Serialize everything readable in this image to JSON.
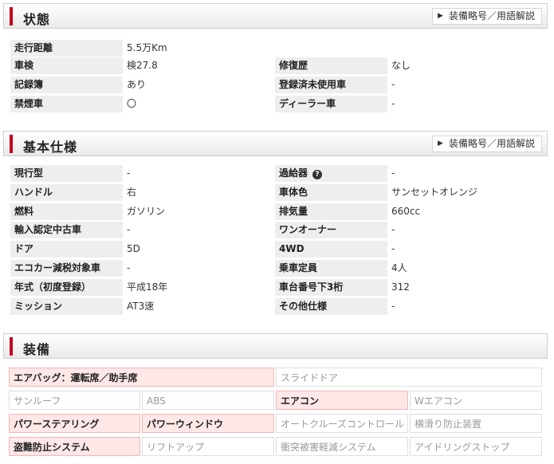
{
  "glossary_label": "装備略号／用語解説",
  "status": {
    "title": "状態",
    "rows": [
      {
        "label": "走行距離",
        "value": "5.5万Km"
      },
      {
        "label": "車検",
        "value": "検27.8"
      },
      {
        "label": "記録簿",
        "value": "あり"
      },
      {
        "label": "禁煙車",
        "value": "〇"
      }
    ],
    "rows_right": [
      {
        "label": "修復歴",
        "value": "なし"
      },
      {
        "label": "登録済未使用車",
        "value": "-"
      },
      {
        "label": "ディーラー車",
        "value": "-"
      }
    ]
  },
  "specs": {
    "title": "基本仕様",
    "left": [
      {
        "label": "現行型",
        "value": "-"
      },
      {
        "label": "ハンドル",
        "value": "右"
      },
      {
        "label": "燃料",
        "value": "ガソリン"
      },
      {
        "label": "輸入認定中古車",
        "value": "-"
      },
      {
        "label": "ドア",
        "value": "5D"
      },
      {
        "label": "エコカー減税対象車",
        "value": "-"
      },
      {
        "label": "年式（初度登録）",
        "value": "平成18年"
      },
      {
        "label": "ミッション",
        "value": "AT3速"
      }
    ],
    "right": [
      {
        "label": "過給器",
        "value": "-"
      },
      {
        "label": "車体色",
        "value": "サンセットオレンジ"
      },
      {
        "label": "排気量",
        "value": "660cc"
      },
      {
        "label": "ワンオーナー",
        "value": "-"
      },
      {
        "label": "4WD",
        "value": "-"
      },
      {
        "label": "乗車定員",
        "value": "4人"
      },
      {
        "label": "車台番号下3桁",
        "value": "312"
      },
      {
        "label": "その他仕様",
        "value": "-"
      }
    ]
  },
  "equipment": {
    "title": "装備",
    "items": [
      {
        "label": "エアバッグ：運転席／助手席",
        "on": true
      },
      {
        "label": "スライドドア",
        "on": false
      },
      {
        "label": "サンルーフ",
        "on": false
      },
      {
        "label": "ABS",
        "on": false
      },
      {
        "label": "エアコン",
        "on": true
      },
      {
        "label": "Wエアコン",
        "on": false
      },
      {
        "label": "パワーステアリング",
        "on": true
      },
      {
        "label": "パワーウィンドウ",
        "on": true
      },
      {
        "label": "オートクルーズコントロール",
        "on": false
      },
      {
        "label": "横滑り防止装置",
        "on": false
      },
      {
        "label": "盗難防止システム",
        "on": true
      },
      {
        "label": "リフトアップ",
        "on": false
      },
      {
        "label": "衝突被害軽減システム",
        "on": false
      },
      {
        "label": "アイドリングストップ",
        "on": false
      }
    ]
  }
}
